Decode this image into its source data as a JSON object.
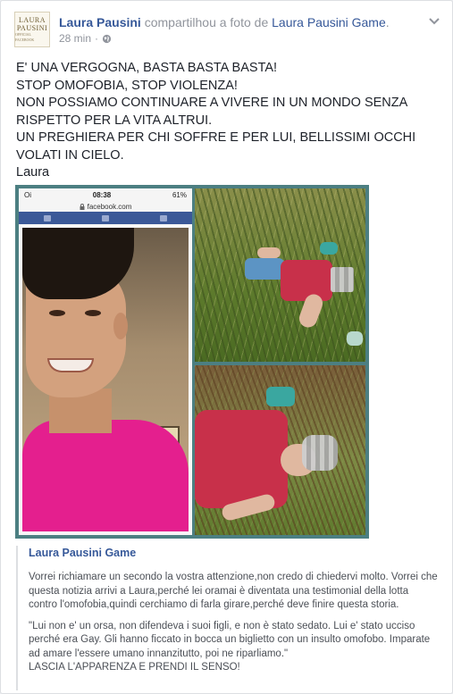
{
  "post": {
    "author": "Laura Pausini",
    "shared_text": "compartilhou a foto de",
    "source_page": "Laura Pausini Game",
    "time": "28 min",
    "privacy_icon": "globe-icon",
    "menu_icon": "chevron-down-icon",
    "avatar": {
      "line1": "LAURA",
      "line2": "PAUSINI",
      "line3": "OFFICIAL FACEBOOK"
    },
    "message": [
      "E' UNA VERGOGNA, BASTA BASTA BASTA!",
      "STOP OMOFOBIA, STOP VIOLENZA!",
      "NON POSSIAMO CONTINUARE A VIVERE IN UN MONDO SENZA RISPETTO PER LA VITA ALTRUI.",
      "UN PREGHIERA PER CHI SOFFRE E PER LUI, BELLISSIMI OCCHI VOLATI IN CIELO.",
      "Laura"
    ]
  },
  "photo": {
    "phone": {
      "time": "08:38",
      "battery": "61%",
      "url": "facebook.com",
      "carrier": "Oi"
    }
  },
  "shared_post": {
    "title": "Laura Pausini Game",
    "paragraphs": [
      "Vorrei richiamare un secondo la vostra attenzione,non credo di chiedervi molto. Vorrei che questa notizia arrivi a Laura,perché lei oramai è diventata una testimonial della lotta contro l'omofobia,quindi cerchiamo di farla girare,perché deve finire questa storia.",
      "\"Lui non e' un orsa, non difendeva i suoi figli, e non è stato sedato. Lui e' stato ucciso perché era Gay. Gli hanno ficcato in bocca un biglietto con un insulto omofobo. Imparate ad amare l'essere umano innanzitutto, poi ne riparliamo.\"\nLASCIA L'APPARENZA E PRENDI IL SENSO!"
    ]
  },
  "colors": {
    "link": "#365899",
    "muted": "#90949c",
    "frame": "#4c7f82",
    "shirt": "#e41f8e"
  }
}
